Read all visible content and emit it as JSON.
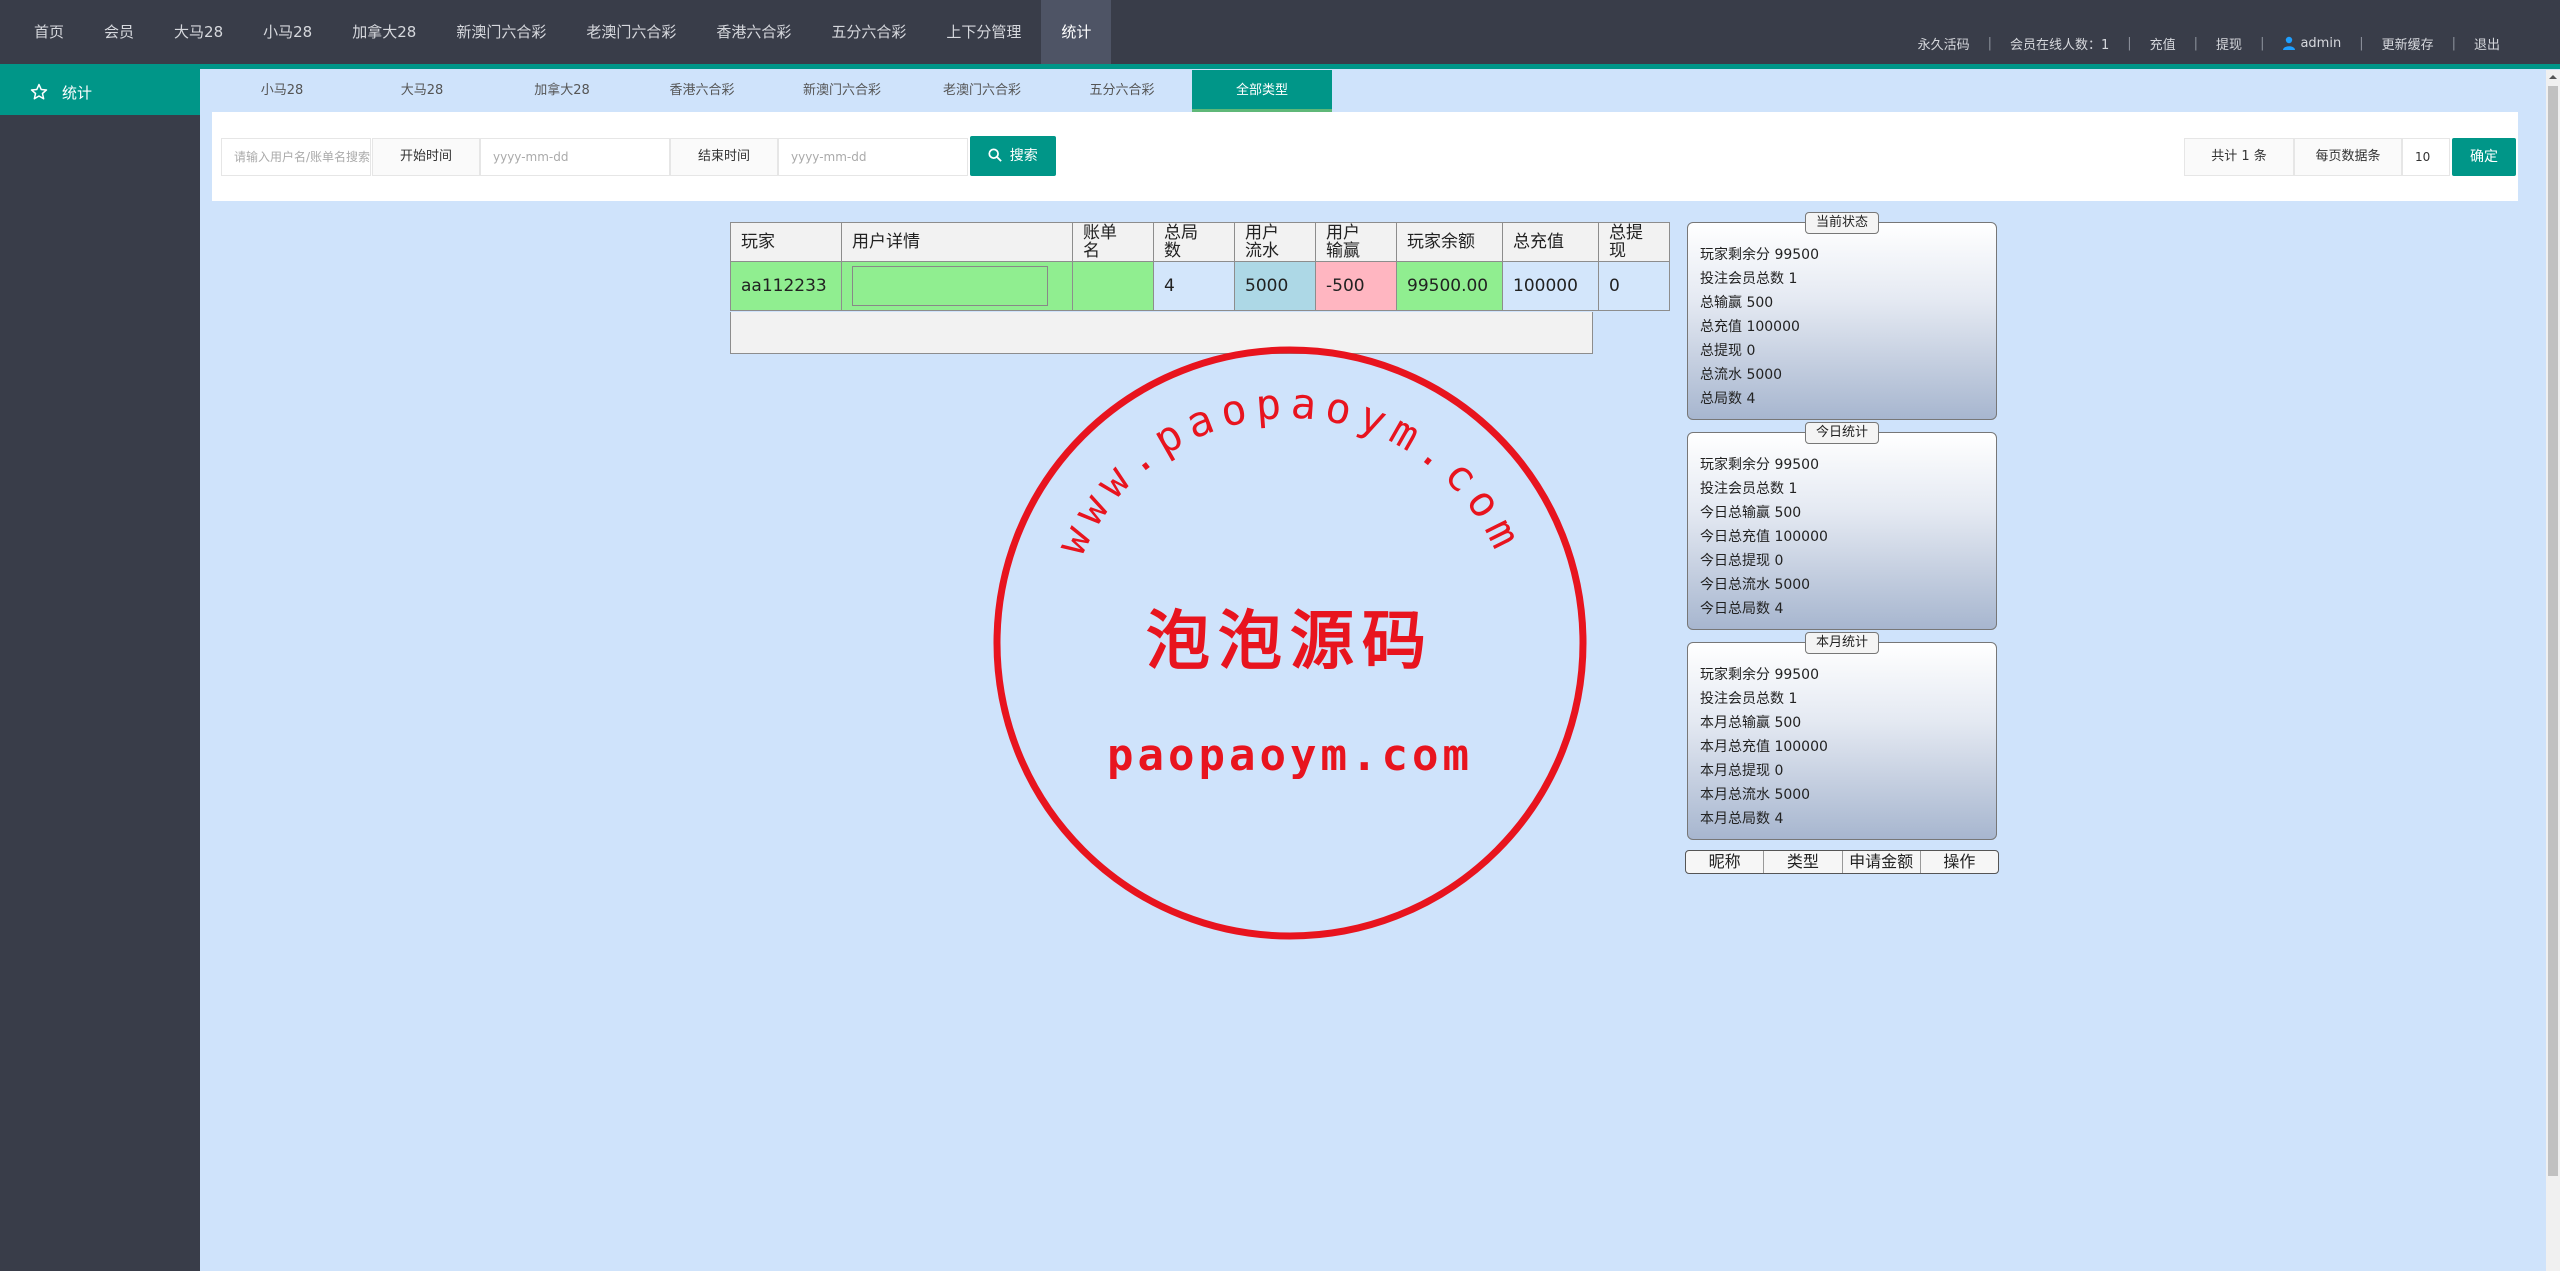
{
  "topnav": {
    "items": [
      "首页",
      "会员",
      "大马28",
      "小马28",
      "加拿大28",
      "新澳门六合彩",
      "老澳门六合彩",
      "香港六合彩",
      "五分六合彩",
      "上下分管理",
      "统计"
    ],
    "active_index": 10,
    "right": {
      "permanent": "永久活码",
      "online": "会员在线人数：1",
      "recharge": "充值",
      "withdraw": "提现",
      "user": "admin",
      "clear_cache": "更新缓存",
      "logout": "退出"
    }
  },
  "sidebar": {
    "items": [
      {
        "label": "统计",
        "icon": "star-icon"
      }
    ]
  },
  "subtabs": {
    "items": [
      "小马28",
      "大马28",
      "加拿大28",
      "香港六合彩",
      "新澳门六合彩",
      "老澳门六合彩",
      "五分六合彩",
      "全部类型"
    ],
    "active_index": 7
  },
  "search": {
    "user_placeholder": "请输入用户名/账单名搜索",
    "start_label": "开始时间",
    "start_placeholder": "yyyy-mm-dd",
    "end_label": "结束时间",
    "end_placeholder": "yyyy-mm-dd",
    "search_button": "搜索",
    "total": "共计 1 条",
    "per_page_label": "每页数据条",
    "per_page_value": "10",
    "confirm_button": "确定"
  },
  "table": {
    "headers": {
      "player": "玩家",
      "user_detail": "用户详情",
      "bill_name": "账单名",
      "total_rounds": "总局数",
      "user_turnover": "用户流水",
      "user_winloss": "用户输赢",
      "player_balance": "玩家余额",
      "total_recharge": "总充值",
      "total_withdraw": "总提现"
    },
    "rows": [
      {
        "player": "aa112233",
        "bill_name": "",
        "total_rounds": "4",
        "user_turnover": "5000",
        "user_winloss": "-500",
        "player_balance": "99500.00",
        "total_recharge": "100000",
        "total_withdraw": "0"
      }
    ]
  },
  "stats": {
    "current": {
      "title": "当前状态",
      "lines": [
        "玩家剩余分 99500",
        "投注会员总数 1",
        "总输赢 500",
        "总充值 100000",
        "总提现 0",
        "总流水 5000",
        "总局数 4"
      ]
    },
    "today": {
      "title": "今日统计",
      "lines": [
        "玩家剩余分 99500",
        "投注会员总数 1",
        "今日总输赢 500",
        "今日总充值 100000",
        "今日总提现 0",
        "今日总流水 5000",
        "今日总局数 4"
      ]
    },
    "month": {
      "title": "本月统计",
      "lines": [
        "玩家剩余分 99500",
        "投注会员总数 1",
        "本月总输赢 500",
        "本月总充值 100000",
        "本月总提现 0",
        "本月总流水 5000",
        "本月总局数 4"
      ]
    }
  },
  "apply_table": {
    "headers": [
      "昵称",
      "类型",
      "申请金额",
      "操作"
    ]
  },
  "watermark": {
    "arc_text": "www.paopaoym.com",
    "center_text": "泡泡源码",
    "bottom_text": "paopaoym.com",
    "color": "#e8141e"
  },
  "colors": {
    "nav_bg": "#393d49",
    "accent": "#009688",
    "content_bg": "#cfe3fb",
    "green_cell": "#90ee90",
    "blue_cell": "#add8e6",
    "pink_cell": "#ffb6c1"
  }
}
